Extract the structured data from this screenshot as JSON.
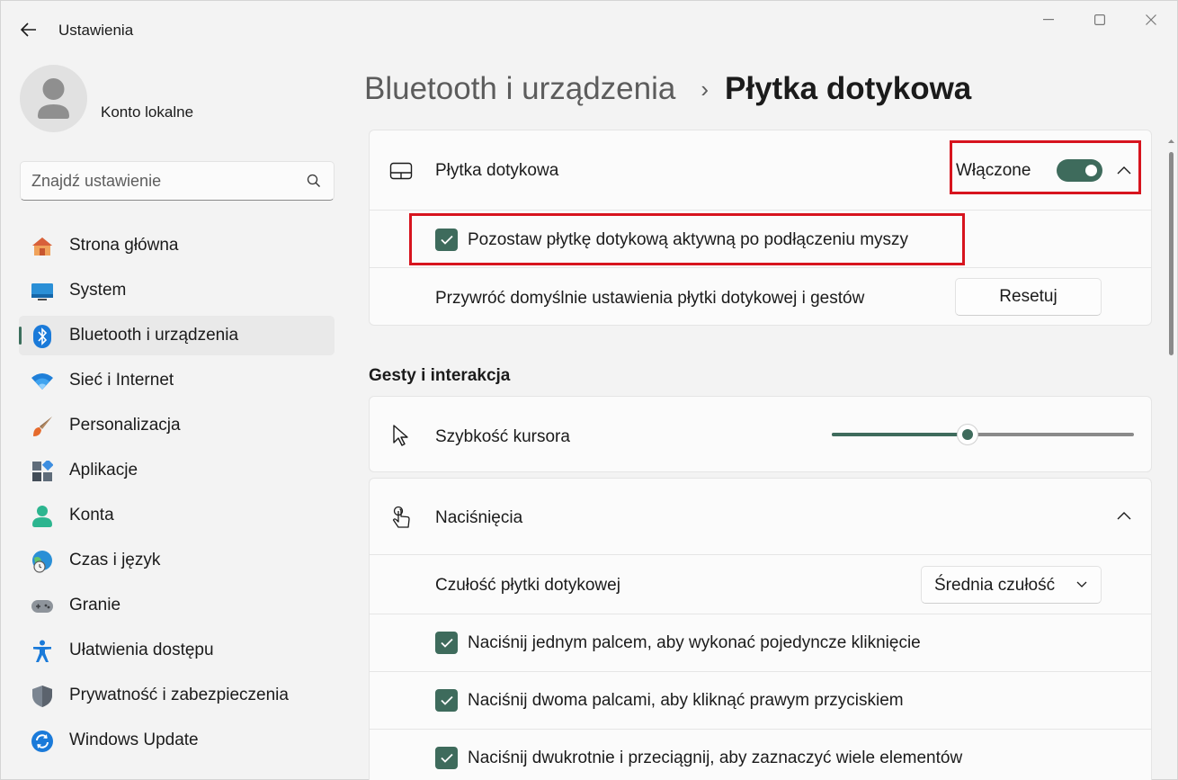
{
  "window": {
    "title": "Ustawienia",
    "controls": [
      "minimize",
      "maximize",
      "close"
    ]
  },
  "account": {
    "name": "Konto lokalne"
  },
  "search": {
    "placeholder": "Znajdź ustawienie"
  },
  "sidebar": {
    "items": [
      {
        "label": "Strona główna",
        "icon": "home-icon",
        "active": false
      },
      {
        "label": "System",
        "icon": "system-icon",
        "active": false
      },
      {
        "label": "Bluetooth i urządzenia",
        "icon": "bluetooth-icon",
        "active": true
      },
      {
        "label": "Sieć i Internet",
        "icon": "wifi-icon",
        "active": false
      },
      {
        "label": "Personalizacja",
        "icon": "brush-icon",
        "active": false
      },
      {
        "label": "Aplikacje",
        "icon": "apps-icon",
        "active": false
      },
      {
        "label": "Konta",
        "icon": "account-icon",
        "active": false
      },
      {
        "label": "Czas i język",
        "icon": "globe-clock-icon",
        "active": false
      },
      {
        "label": "Granie",
        "icon": "gamepad-icon",
        "active": false
      },
      {
        "label": "Ułatwienia dostępu",
        "icon": "accessibility-icon",
        "active": false
      },
      {
        "label": "Prywatność i zabezpieczenia",
        "icon": "shield-icon",
        "active": false
      },
      {
        "label": "Windows Update",
        "icon": "update-icon",
        "active": false
      }
    ]
  },
  "breadcrumb": {
    "parent": "Bluetooth i urządzenia",
    "separator": "›",
    "current": "Płytka dotykowa"
  },
  "touchpad_card": {
    "title": "Płytka dotykowa",
    "toggle_state_label": "Włączone",
    "toggle_on": true,
    "keep_active_checkbox": {
      "label": "Pozostaw płytkę dotykową aktywną po podłączeniu myszy",
      "checked": true
    },
    "reset_row_label": "Przywróć domyślnie ustawienia płytki dotykowej i gestów",
    "reset_button": "Resetuj"
  },
  "gestures_section": {
    "title": "Gesty i interakcja"
  },
  "cursor_speed": {
    "label": "Szybkość kursora",
    "value_fraction": 0.45
  },
  "taps": {
    "title": "Naciśnięcia",
    "sensitivity_label": "Czułość płytki dotykowej",
    "sensitivity_value": "Średnia czułość",
    "options": [
      {
        "label": "Naciśnij jednym palcem, aby wykonać pojedyncze kliknięcie",
        "checked": true
      },
      {
        "label": "Naciśnij dwoma palcami, aby kliknąć prawym przyciskiem",
        "checked": true
      },
      {
        "label": "Naciśnij dwukrotnie i przeciągnij, aby zaznaczyć wiele elementów",
        "checked": true
      }
    ]
  },
  "colors": {
    "accent": "#3e6b5c",
    "highlight": "#d7141e",
    "background": "#f3f3f3",
    "card": "#fbfbfb"
  }
}
